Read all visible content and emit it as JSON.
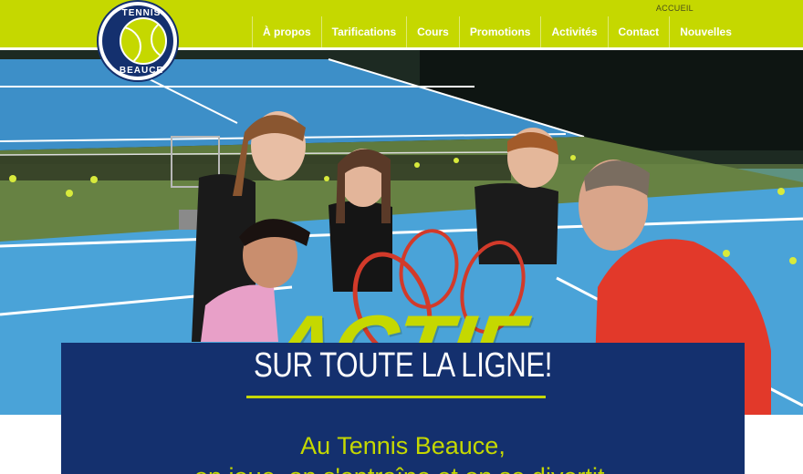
{
  "header": {
    "breadcrumb": "ACCUEIL",
    "brand_color": "#c5d800",
    "navy_color": "#14306e"
  },
  "logo": {
    "text_top": "TENNIS",
    "text_bottom": "BEAUCE",
    "icon": "tennis-ball-icon"
  },
  "nav": {
    "items": [
      {
        "label": "À propos"
      },
      {
        "label": "Tarifications"
      },
      {
        "label": "Cours"
      },
      {
        "label": "Promotions"
      },
      {
        "label": "Activités"
      },
      {
        "label": "Contact"
      },
      {
        "label": "Nouvelles"
      }
    ]
  },
  "hero": {
    "headline": "ACTIF"
  },
  "banner": {
    "title": "SUR TOUTE LA LIGNE!",
    "line1": "Au Tennis Beauce,",
    "line2": "on joue, on s'entraîne et on se divertit."
  }
}
